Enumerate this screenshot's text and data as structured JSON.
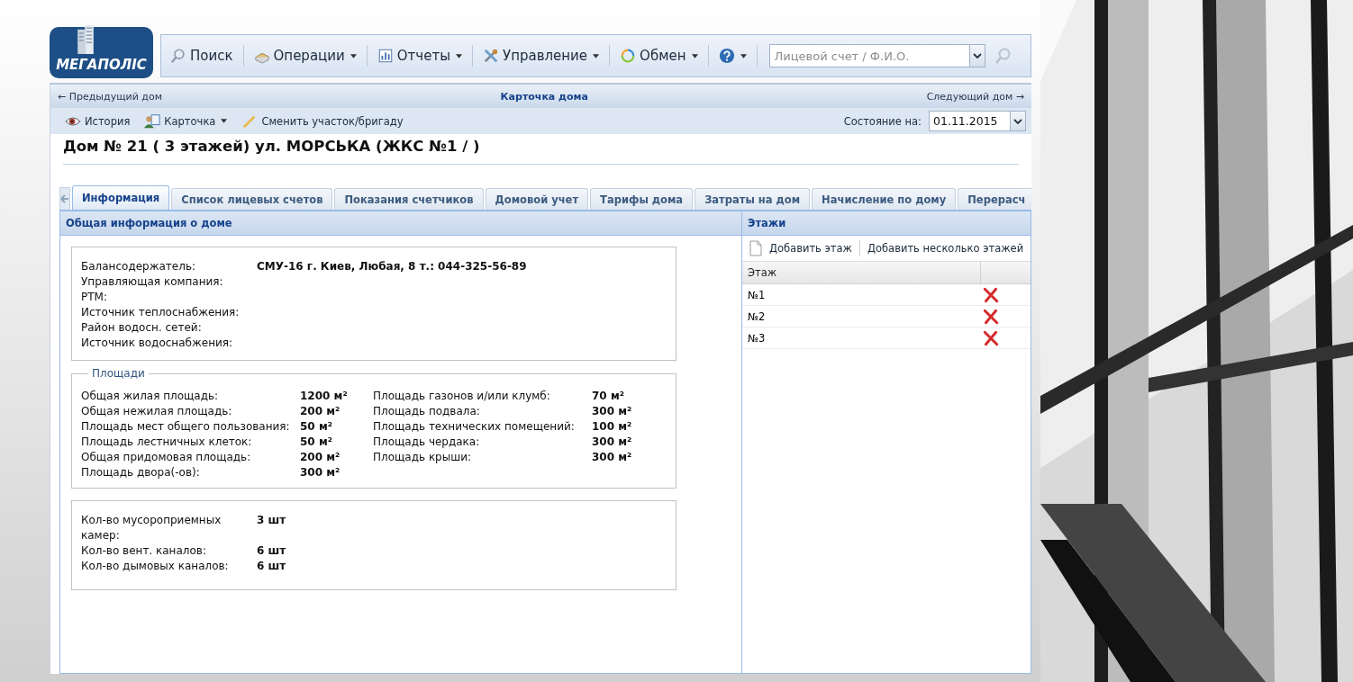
{
  "logo": {
    "text": "МЕГАПОЛІС"
  },
  "menu": [
    {
      "kind": "search",
      "label": "Поиск",
      "dropdown": false
    },
    {
      "kind": "operations",
      "label": "Операции",
      "dropdown": true
    },
    {
      "kind": "reports",
      "label": "Отчеты",
      "dropdown": true
    },
    {
      "kind": "tools",
      "label": "Управление",
      "dropdown": true
    },
    {
      "kind": "exchange",
      "label": "Обмен",
      "dropdown": true
    },
    {
      "kind": "help",
      "dropdown": true
    }
  ],
  "account_search": {
    "placeholder": "Лицевой счет / Ф.И.О."
  },
  "nav": {
    "previous": "← Предыдущий дом",
    "title": "Карточка дома",
    "next": "Следующий дом →"
  },
  "toolbar": [
    {
      "kind": "history",
      "label": "История",
      "dropdown": false
    },
    {
      "kind": "card",
      "label": "Карточка",
      "dropdown": true
    },
    {
      "kind": "pencil",
      "label": "Сменить участок/бригаду",
      "dropdown": false
    }
  ],
  "state_date": {
    "label": "Состояние на:",
    "value": "01.11.2015"
  },
  "house_title": "Дом № 21 ( 3 этажей) ул. МОРСЬКА (ЖКС №1 / )",
  "tabs": [
    {
      "label": "Информация",
      "selected": true
    },
    {
      "label": "Список лицевых счетов",
      "selected": false
    },
    {
      "label": "Показания счетчиков",
      "selected": false
    },
    {
      "label": "Домовой учет",
      "selected": false
    },
    {
      "label": "Тарифы дома",
      "selected": false
    },
    {
      "label": "Затраты на дом",
      "selected": false
    },
    {
      "label": "Начисление по дому",
      "selected": false
    },
    {
      "label": "Перерасч",
      "selected": false
    }
  ],
  "info": {
    "title": "Общая информация о доме",
    "general": [
      {
        "label": "Балансодержатель:",
        "value": "СМУ-16 г. Киев, Любая, 8 т.: 044-325-56-89"
      },
      {
        "label": "Управляющая компания:"
      },
      {
        "label": "РТМ:"
      },
      {
        "label": "Источник теплоснабжения:"
      },
      {
        "label": "Район водосн. сетей:"
      },
      {
        "label": "Источник водоснабжения:"
      }
    ],
    "areas": {
      "legend": "Площади",
      "left": [
        {
          "label": "Общая жилая площадь:",
          "value": "1200 м²"
        },
        {
          "label": "Общая нежилая площадь:",
          "value": "200 м²"
        },
        {
          "label": "Площадь мест общего пользования:",
          "value": "50 м²"
        },
        {
          "label": "Площадь лестничных клеток:",
          "value": "50 м²"
        },
        {
          "label": "Общая придомовая площадь:",
          "value": "200 м²"
        },
        {
          "label": "Площадь двора(-ов):",
          "value": "300 м²"
        }
      ],
      "right": [
        {
          "label": "Площадь газонов и/или клумб:",
          "value": "70 м²"
        },
        {
          "label": "Площадь подвала:",
          "value": "300 м²"
        },
        {
          "label": "Площадь технических помещений:",
          "value": "100 м²"
        },
        {
          "label": "Площадь чердака:",
          "value": "300 м²"
        },
        {
          "label": "Площадь крыши:",
          "value": "300 м²"
        }
      ]
    },
    "counts": [
      {
        "label": "Кол-во мусороприемных камер:",
        "value": "3 шт"
      },
      {
        "label": "Кол-во вент. каналов:",
        "value": "6 шт"
      },
      {
        "label": "Кол-во дымовых каналов:",
        "value": "6 шт"
      }
    ]
  },
  "floors": {
    "title": "Этажи",
    "actions": [
      {
        "kind": "new",
        "label": "Добавить этаж"
      },
      {
        "kind": "plain",
        "label": "Добавить несколько этажей"
      }
    ],
    "column": "Этаж",
    "rows": [
      {
        "name": "№1"
      },
      {
        "name": "№2"
      },
      {
        "name": "№3"
      }
    ]
  }
}
